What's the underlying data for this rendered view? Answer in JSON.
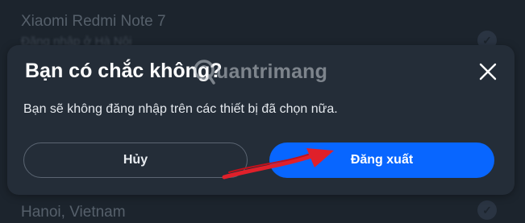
{
  "background": {
    "device_name": "Xiaomi Redmi Note 7",
    "device_location_blurred": "Đăng nhập ở Hà Nội",
    "location": "Hanoi, Vietnam"
  },
  "dialog": {
    "title": "Bạn có chắc không?",
    "message": "Bạn sẽ không đăng nhập trên các thiết bị đã chọn nữa.",
    "cancel_label": "Hủy",
    "logout_label": "Đăng xuất"
  },
  "watermark": {
    "text": "uantrimang"
  },
  "colors": {
    "background": "#1c242d",
    "dialog": "#242d38",
    "primary": "#0866ff",
    "annotation_arrow": "#e0202a"
  }
}
